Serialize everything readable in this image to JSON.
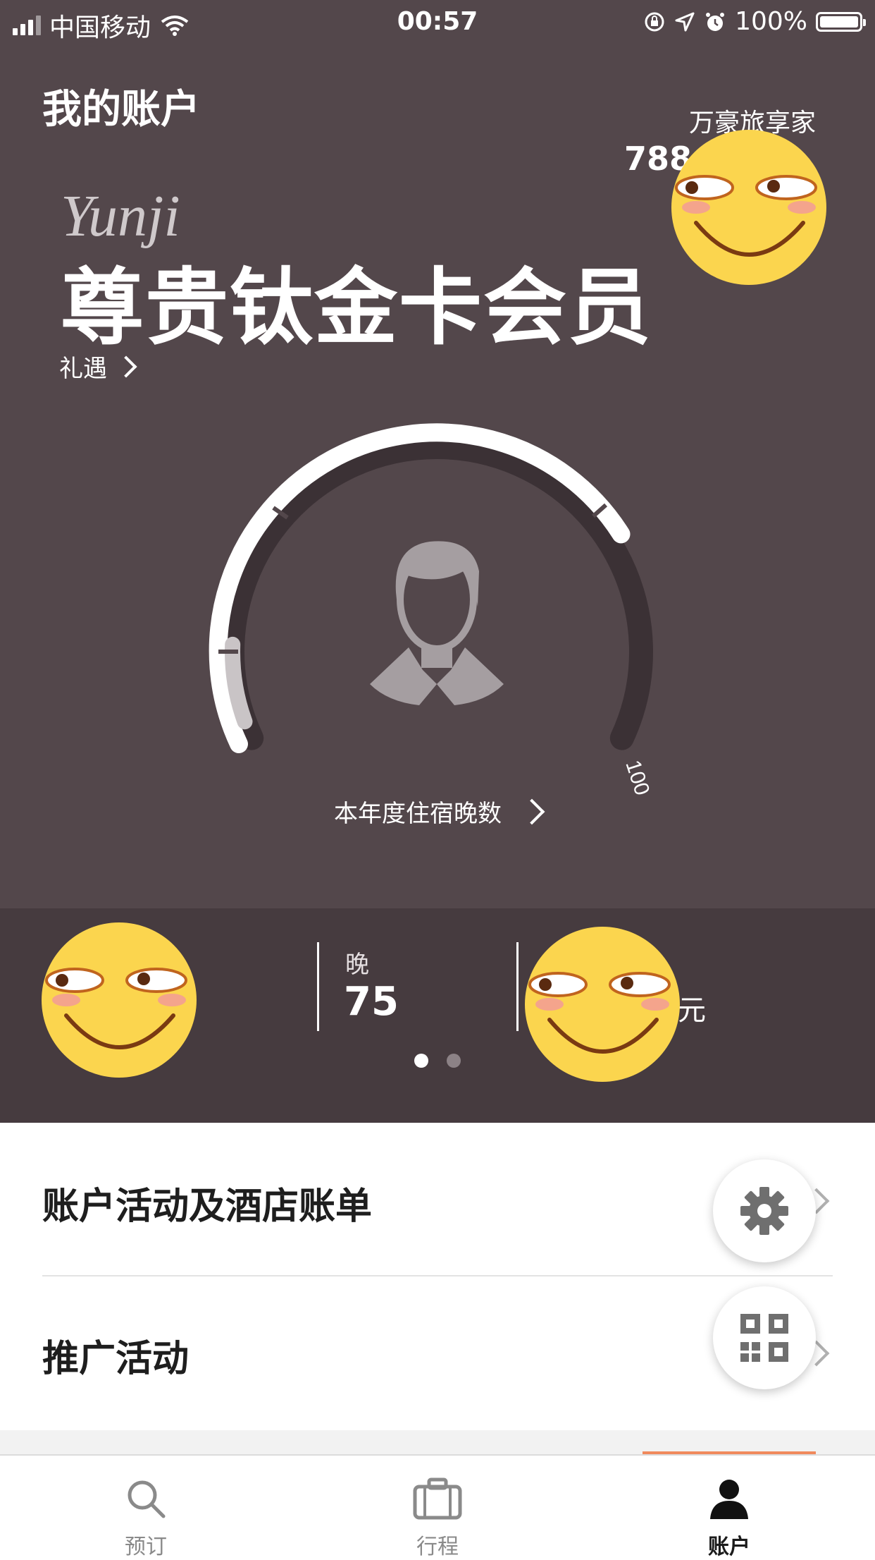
{
  "status_bar": {
    "carrier": "中国移动",
    "time": "00:57",
    "battery": "100%"
  },
  "header": {
    "title": "我的账户",
    "program_name": "万豪旅享家",
    "points_partial": "788",
    "brand_script": "Yunji",
    "tier_name": "尊贵钛金卡会员",
    "benefits_link": "礼遇"
  },
  "gauge": {
    "max_label": "100",
    "caption": "本年度住宿晚数",
    "value_fraction": 0.75
  },
  "summary": {
    "nights_label": "晚",
    "nights_value": "75",
    "currency_unit": "元",
    "page_count": 2,
    "active_page": 1
  },
  "menu": {
    "items": [
      {
        "label": "账户活动及酒店账单"
      },
      {
        "label": "推广活动"
      }
    ],
    "fab_icons": [
      "gear-icon",
      "qr-code-icon"
    ]
  },
  "tabbar": {
    "tabs": [
      {
        "label": "预订",
        "icon": "search-icon"
      },
      {
        "label": "行程",
        "icon": "suitcase-icon"
      },
      {
        "label": "账户",
        "icon": "person-icon",
        "active": true
      }
    ],
    "active_color": "#f08a5d"
  },
  "colors": {
    "header_bg": "#53474b",
    "summary_bg": "#463b3f"
  }
}
